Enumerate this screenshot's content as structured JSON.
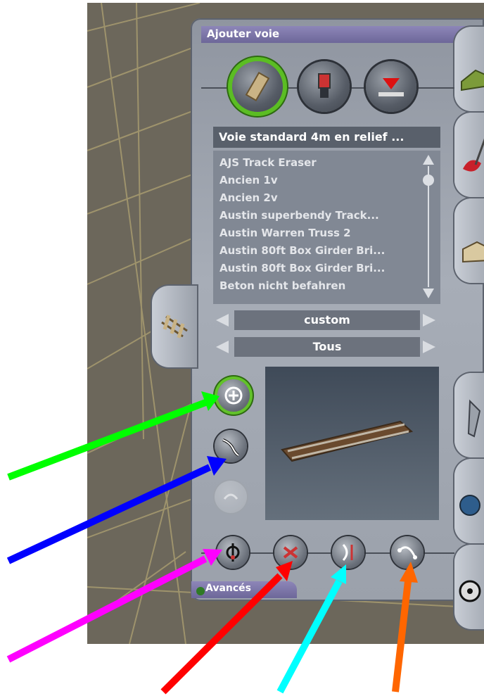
{
  "window": {
    "title": "Ajouter voie"
  },
  "category_buttons": [
    {
      "icon": "track-icon",
      "active": true
    },
    {
      "icon": "signal-icon",
      "active": false
    },
    {
      "icon": "junction-icon",
      "active": false
    }
  ],
  "track_list": {
    "selected": "Voie standard 4m en relief ...",
    "items": [
      "AJS Track Eraser",
      "Ancien 1v",
      "Ancien 2v",
      "Austin superbendy Track...",
      "Austin Warren Truss 2",
      "Austin 80ft Box Girder Bri...",
      "Austin 80ft Box Girder Bri...",
      "Beton nicht befahren"
    ]
  },
  "filters": {
    "region": "custom",
    "category": "Tous"
  },
  "side_tools": [
    {
      "icon": "add-icon",
      "state": "active"
    },
    {
      "icon": "bend-icon",
      "state": "normal"
    },
    {
      "icon": "smooth-icon",
      "state": "disabled"
    }
  ],
  "bottom_tools": [
    "move-icon",
    "delete-icon",
    "split-icon",
    "curve-icon"
  ],
  "advanced": {
    "label": "Avancés"
  },
  "right_tabs": [
    "terrain-icon",
    "paint-icon",
    "objects-icon",
    "tools-icon",
    "world-icon",
    "wheel-icon"
  ],
  "annotation_colors": [
    "#00ff00",
    "#0000ff",
    "#ff00ff",
    "#ff0000",
    "#00ffff",
    "#ff6600"
  ]
}
